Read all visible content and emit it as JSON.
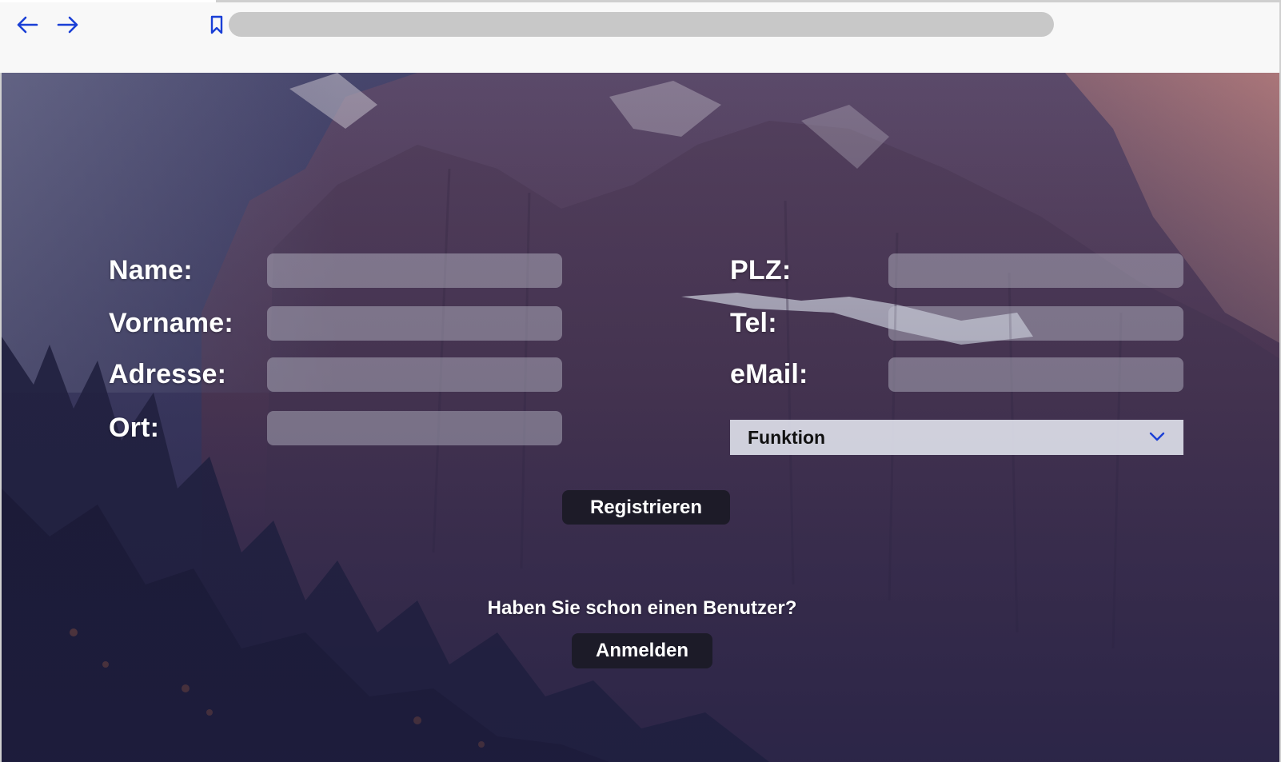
{
  "browser": {
    "back_icon": "arrow-left-icon",
    "forward_icon": "arrow-right-icon",
    "bookmark_icon": "bookmark-icon",
    "url": "",
    "accent_color": "#1a3fd6"
  },
  "form": {
    "left_fields": [
      {
        "label": "Name:",
        "value": ""
      },
      {
        "label": "Vorname:",
        "value": ""
      },
      {
        "label": "Adresse:",
        "value": ""
      },
      {
        "label": "Ort:",
        "value": ""
      }
    ],
    "right_fields": [
      {
        "label": "PLZ:",
        "value": ""
      },
      {
        "label": "Tel:",
        "value": ""
      },
      {
        "label": "eMail:",
        "value": ""
      }
    ],
    "function_select": {
      "selected": "Funktion",
      "icon": "chevron-down-icon"
    },
    "register_label": "Registrieren"
  },
  "login": {
    "question": "Haben Sie schon einen Benutzer?",
    "login_label": "Anmelden"
  },
  "background": {
    "description_icon": "mountain-background-image"
  }
}
